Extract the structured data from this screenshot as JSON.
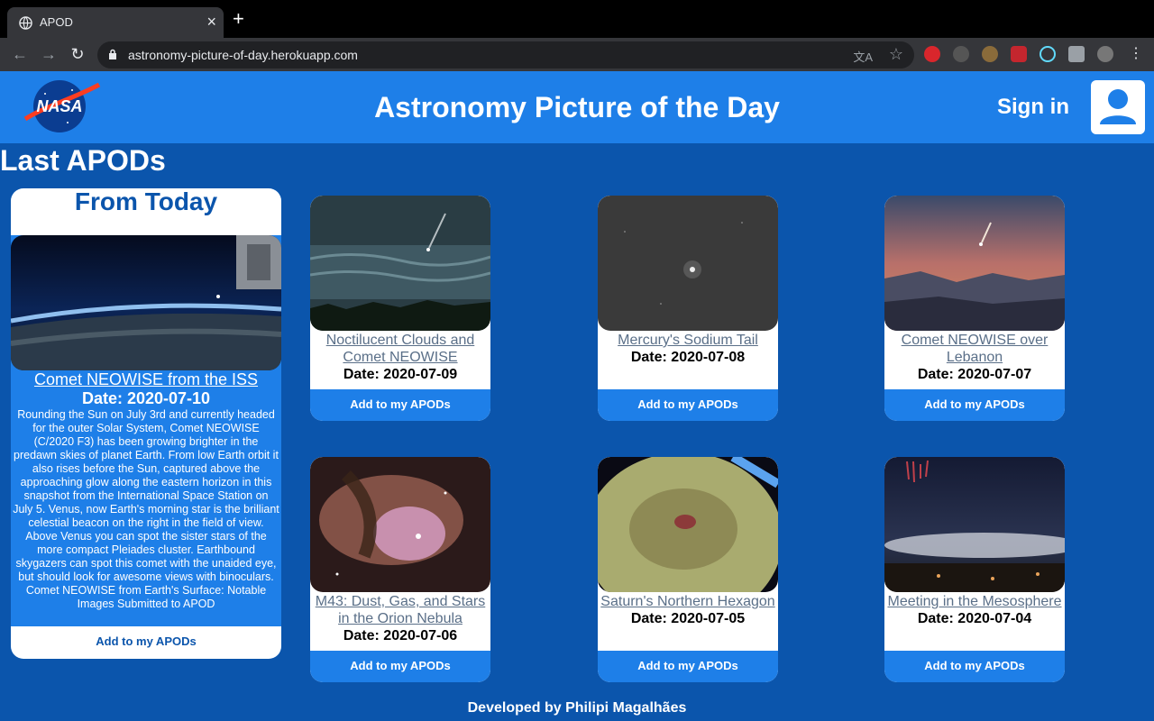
{
  "browser": {
    "tab_title": "APOD",
    "url": "astronomy-picture-of-day.herokuapp.com"
  },
  "header": {
    "title": "Astronomy Picture of the Day",
    "sign_in": "Sign in"
  },
  "section_title": "Last APODs",
  "today": {
    "heading": "From Today",
    "title": "Comet NEOWISE from the ISS",
    "date": "Date: 2020-07-10",
    "description": "Rounding the Sun on July 3rd and currently headed for the outer Solar System, Comet NEOWISE (C/2020 F3) has been growing brighter in the predawn skies of planet Earth. From low Earth orbit it also rises before the Sun, captured above the approaching glow along the eastern horizon in this snapshot from the International Space Station on July 5. Venus, now Earth's morning star is the brilliant celestial beacon on the right in the field of view. Above Venus you can spot the sister stars of the more compact Pleiades cluster. Earthbound skygazers can spot this comet with the unaided eye, but should look for awesome views with binoculars. Comet NEOWISE from Earth's Surface: Notable Images Submitted to APOD",
    "add_label": "Add to my APODs"
  },
  "cards": [
    {
      "title": "Noctilucent Clouds and Comet NEOWISE",
      "date": "Date: 2020-07-09",
      "add_label": "Add to my APODs"
    },
    {
      "title": "Mercury's Sodium Tail",
      "date": "Date: 2020-07-08",
      "add_label": "Add to my APODs"
    },
    {
      "title": "Comet NEOWISE over Lebanon",
      "date": "Date: 2020-07-07",
      "add_label": "Add to my APODs"
    },
    {
      "title": "M43: Dust, Gas, and Stars in the Orion Nebula",
      "date": "Date: 2020-07-06",
      "add_label": "Add to my APODs"
    },
    {
      "title": "Saturn's Northern Hexagon",
      "date": "Date: 2020-07-05",
      "add_label": "Add to my APODs"
    },
    {
      "title": "Meeting in the Mesosphere",
      "date": "Date: 2020-07-04",
      "add_label": "Add to my APODs"
    }
  ],
  "footer": "Developed by Philipi Magalhães",
  "colors": {
    "page_bg": "#0b55ac",
    "header_bg": "#1e7fe8",
    "link_gray": "#5a6f88"
  }
}
